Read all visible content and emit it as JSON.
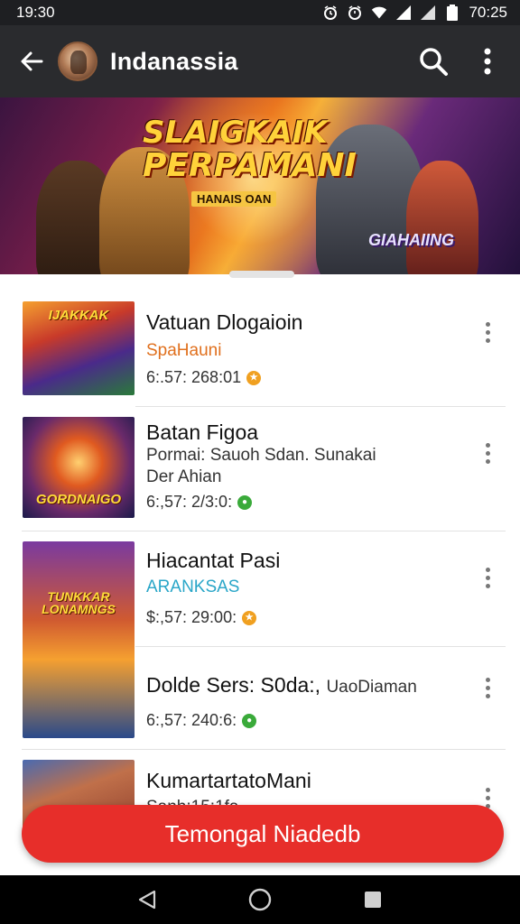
{
  "status_bar": {
    "time_left": "19:30",
    "time_right": "70:25",
    "icons": [
      "alarm-icon",
      "alarm-icon",
      "wifi-icon",
      "signal-icon",
      "signal-icon",
      "battery-icon"
    ]
  },
  "app_bar": {
    "title": "Indanassia",
    "back_icon": "arrow-left-icon",
    "search_icon": "search-icon",
    "more_icon": "more-vert-icon"
  },
  "banner": {
    "headline_1": "SLAIGKAIK",
    "headline_2": "PERPAMANI",
    "subtitle": "HANAIS OAN",
    "logo": "GIAHAIING"
  },
  "items": [
    {
      "title": "Vatuan Dlogaioin",
      "subtitle": "SpaHauni",
      "subtitle_color": "#e0701e",
      "meta": "6:.57: 268:01",
      "badge_color": "#f0a020",
      "thumb_text": "IJAKKAK"
    },
    {
      "title": "Batan Figoa",
      "subtitle": "Pormai: Sauoh Sdan. Sunakai",
      "subtitle_2": "Der Ahian",
      "subtitle_color": "#333333",
      "meta": "6:,57: 2/3:0:",
      "badge_color": "#3aaa3a",
      "thumb_text": "GORDNAIGO"
    },
    {
      "title": "Hiacantat Pasi",
      "subtitle": "ARANKSAS",
      "subtitle_color": "#2aa6c8",
      "meta": "$:,57: 29:00:",
      "badge_color": "#f0a020",
      "thumb_text": "TUNKKAR LONAMNGS"
    },
    {
      "title": "Dolde Sers: S0da:,",
      "title_suffix": "UaoDiaman",
      "meta": "6:,57: 240:6:",
      "badge_color": "#3aaa3a"
    },
    {
      "title": "KumartartatoMani",
      "subtitle": "Sanh:15:1fa",
      "subtitle_color": "#333333"
    }
  ],
  "fab": {
    "label": "Temongal Niadedb"
  },
  "nav": {
    "back_icon": "nav-back-icon",
    "home_icon": "nav-home-icon",
    "recents_icon": "nav-recents-icon"
  }
}
